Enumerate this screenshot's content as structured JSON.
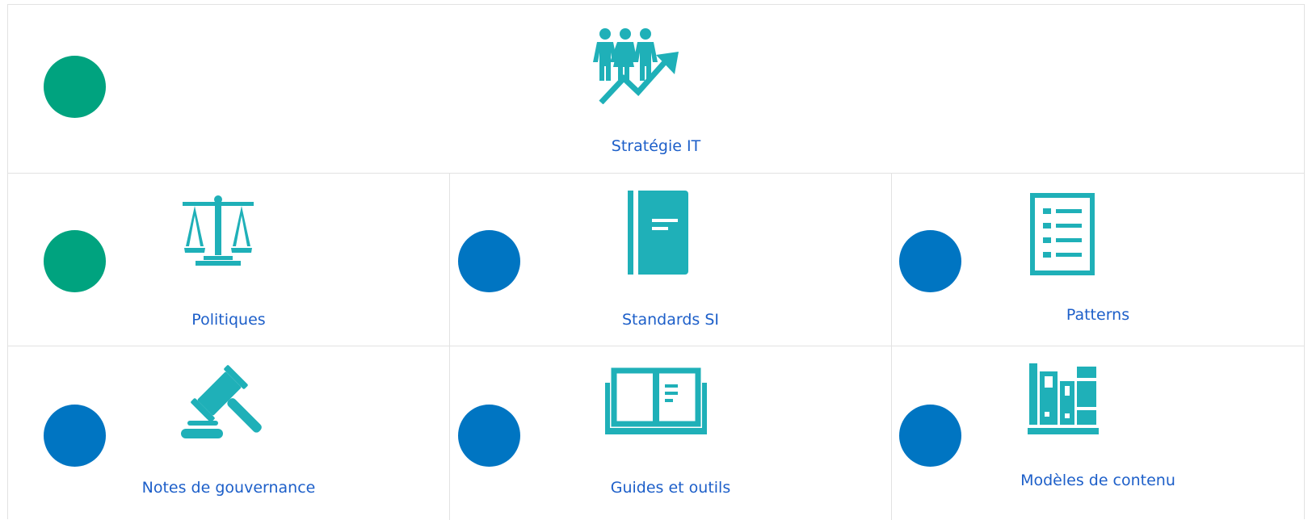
{
  "colors": {
    "icon_teal": "#1fb0b8",
    "label_blue": "#1d5fc9",
    "dot_green": "#00a37f",
    "dot_blue": "#0075c2",
    "border": "#e2e2e2"
  },
  "tiles": {
    "strategie": {
      "label": "Stratégie IT",
      "icon": "people-growth-icon",
      "status": "green"
    },
    "politiques": {
      "label": "Politiques",
      "icon": "scales-icon",
      "status": "green"
    },
    "standards": {
      "label": "Standards SI",
      "icon": "book-icon",
      "status": "blue"
    },
    "patterns": {
      "label": "Patterns",
      "icon": "checklist-icon",
      "status": "blue"
    },
    "notes": {
      "label": "Notes de gouvernance",
      "icon": "gavel-icon",
      "status": "blue"
    },
    "guides": {
      "label": "Guides et outils",
      "icon": "open-book-icon",
      "status": "blue"
    },
    "modeles": {
      "label": "Modèles de contenu",
      "icon": "bookshelf-icon",
      "status": "blue"
    }
  }
}
